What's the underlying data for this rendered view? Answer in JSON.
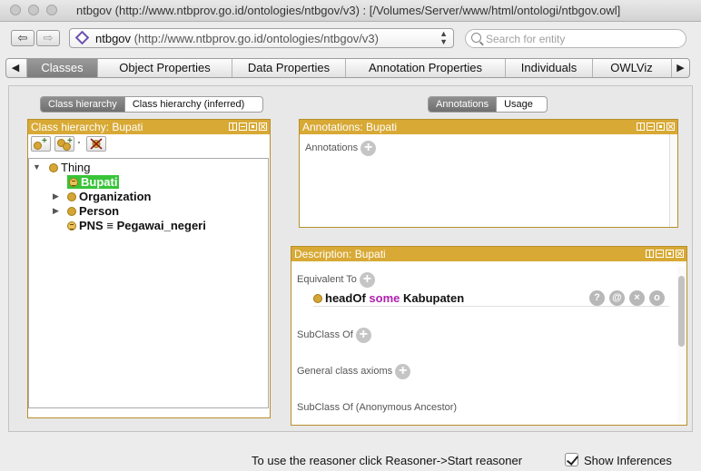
{
  "window": {
    "title": "ntbgov (http://www.ntbprov.go.id/ontologies/ntbgov/v3)  : [/Volumes/Server/www/html/ontologi/ntbgov.owl]"
  },
  "toolbar": {
    "ontology_name": "ntbgov",
    "ontology_uri": "(http://www.ntbprov.go.id/ontologies/ntbgov/v3)",
    "search_placeholder": "Search for entity"
  },
  "tabs": [
    {
      "label": "Classes",
      "active": true
    },
    {
      "label": "Object Properties"
    },
    {
      "label": "Data Properties"
    },
    {
      "label": "Annotation Properties"
    },
    {
      "label": "Individuals"
    },
    {
      "label": "OWLViz"
    }
  ],
  "left": {
    "segments": [
      "Class hierarchy",
      "Class hierarchy (inferred)"
    ],
    "header": "Class hierarchy: Bupati",
    "tree": {
      "root": "Thing",
      "children": [
        {
          "label": "Bupati",
          "selected": true,
          "equivalent": true
        },
        {
          "label": "Organization"
        },
        {
          "label": "Person"
        },
        {
          "label": "PNS",
          "eq_symbol": "≡",
          "eq_target": "Pegawai_negeri",
          "equivalent": true
        }
      ]
    }
  },
  "right": {
    "segments": [
      "Annotations",
      "Usage"
    ],
    "annotations_header": "Annotations: Bupati",
    "annotations_label": "Annotations",
    "description_header": "Description: Bupati",
    "sections": {
      "equivalent_to": "Equivalent To",
      "subclass_of": "SubClass Of",
      "general_axioms": "General class axioms",
      "subclass_anon": "SubClass Of (Anonymous Ancestor)"
    },
    "expression": {
      "property": "headOf",
      "keyword": "some",
      "filler": "Kabupaten"
    },
    "actions": [
      "?",
      "@",
      "×",
      "o"
    ]
  },
  "status": {
    "reasoner_text": "To use the reasoner click Reasoner->Start reasoner",
    "show_inferences_label": "Show Inferences",
    "show_inferences_checked": true
  }
}
